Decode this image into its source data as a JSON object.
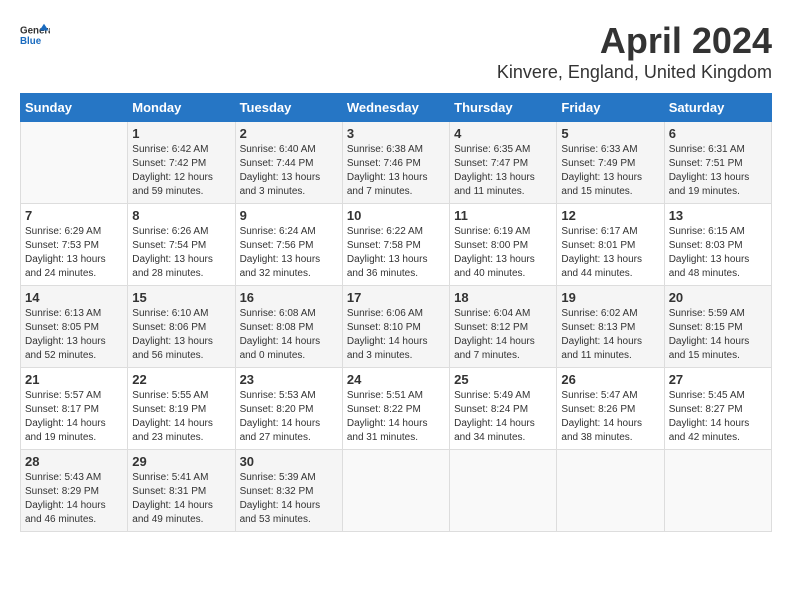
{
  "header": {
    "logo_general": "General",
    "logo_blue": "Blue",
    "title": "April 2024",
    "subtitle": "Kinvere, England, United Kingdom"
  },
  "calendar": {
    "columns": [
      "Sunday",
      "Monday",
      "Tuesday",
      "Wednesday",
      "Thursday",
      "Friday",
      "Saturday"
    ],
    "rows": [
      [
        {
          "day": "",
          "empty": true
        },
        {
          "day": "1",
          "sunrise": "Sunrise: 6:42 AM",
          "sunset": "Sunset: 7:42 PM",
          "daylight": "Daylight: 12 hours and 59 minutes."
        },
        {
          "day": "2",
          "sunrise": "Sunrise: 6:40 AM",
          "sunset": "Sunset: 7:44 PM",
          "daylight": "Daylight: 13 hours and 3 minutes."
        },
        {
          "day": "3",
          "sunrise": "Sunrise: 6:38 AM",
          "sunset": "Sunset: 7:46 PM",
          "daylight": "Daylight: 13 hours and 7 minutes."
        },
        {
          "day": "4",
          "sunrise": "Sunrise: 6:35 AM",
          "sunset": "Sunset: 7:47 PM",
          "daylight": "Daylight: 13 hours and 11 minutes."
        },
        {
          "day": "5",
          "sunrise": "Sunrise: 6:33 AM",
          "sunset": "Sunset: 7:49 PM",
          "daylight": "Daylight: 13 hours and 15 minutes."
        },
        {
          "day": "6",
          "sunrise": "Sunrise: 6:31 AM",
          "sunset": "Sunset: 7:51 PM",
          "daylight": "Daylight: 13 hours and 19 minutes."
        }
      ],
      [
        {
          "day": "7",
          "sunrise": "Sunrise: 6:29 AM",
          "sunset": "Sunset: 7:53 PM",
          "daylight": "Daylight: 13 hours and 24 minutes."
        },
        {
          "day": "8",
          "sunrise": "Sunrise: 6:26 AM",
          "sunset": "Sunset: 7:54 PM",
          "daylight": "Daylight: 13 hours and 28 minutes."
        },
        {
          "day": "9",
          "sunrise": "Sunrise: 6:24 AM",
          "sunset": "Sunset: 7:56 PM",
          "daylight": "Daylight: 13 hours and 32 minutes."
        },
        {
          "day": "10",
          "sunrise": "Sunrise: 6:22 AM",
          "sunset": "Sunset: 7:58 PM",
          "daylight": "Daylight: 13 hours and 36 minutes."
        },
        {
          "day": "11",
          "sunrise": "Sunrise: 6:19 AM",
          "sunset": "Sunset: 8:00 PM",
          "daylight": "Daylight: 13 hours and 40 minutes."
        },
        {
          "day": "12",
          "sunrise": "Sunrise: 6:17 AM",
          "sunset": "Sunset: 8:01 PM",
          "daylight": "Daylight: 13 hours and 44 minutes."
        },
        {
          "day": "13",
          "sunrise": "Sunrise: 6:15 AM",
          "sunset": "Sunset: 8:03 PM",
          "daylight": "Daylight: 13 hours and 48 minutes."
        }
      ],
      [
        {
          "day": "14",
          "sunrise": "Sunrise: 6:13 AM",
          "sunset": "Sunset: 8:05 PM",
          "daylight": "Daylight: 13 hours and 52 minutes."
        },
        {
          "day": "15",
          "sunrise": "Sunrise: 6:10 AM",
          "sunset": "Sunset: 8:06 PM",
          "daylight": "Daylight: 13 hours and 56 minutes."
        },
        {
          "day": "16",
          "sunrise": "Sunrise: 6:08 AM",
          "sunset": "Sunset: 8:08 PM",
          "daylight": "Daylight: 14 hours and 0 minutes."
        },
        {
          "day": "17",
          "sunrise": "Sunrise: 6:06 AM",
          "sunset": "Sunset: 8:10 PM",
          "daylight": "Daylight: 14 hours and 3 minutes."
        },
        {
          "day": "18",
          "sunrise": "Sunrise: 6:04 AM",
          "sunset": "Sunset: 8:12 PM",
          "daylight": "Daylight: 14 hours and 7 minutes."
        },
        {
          "day": "19",
          "sunrise": "Sunrise: 6:02 AM",
          "sunset": "Sunset: 8:13 PM",
          "daylight": "Daylight: 14 hours and 11 minutes."
        },
        {
          "day": "20",
          "sunrise": "Sunrise: 5:59 AM",
          "sunset": "Sunset: 8:15 PM",
          "daylight": "Daylight: 14 hours and 15 minutes."
        }
      ],
      [
        {
          "day": "21",
          "sunrise": "Sunrise: 5:57 AM",
          "sunset": "Sunset: 8:17 PM",
          "daylight": "Daylight: 14 hours and 19 minutes."
        },
        {
          "day": "22",
          "sunrise": "Sunrise: 5:55 AM",
          "sunset": "Sunset: 8:19 PM",
          "daylight": "Daylight: 14 hours and 23 minutes."
        },
        {
          "day": "23",
          "sunrise": "Sunrise: 5:53 AM",
          "sunset": "Sunset: 8:20 PM",
          "daylight": "Daylight: 14 hours and 27 minutes."
        },
        {
          "day": "24",
          "sunrise": "Sunrise: 5:51 AM",
          "sunset": "Sunset: 8:22 PM",
          "daylight": "Daylight: 14 hours and 31 minutes."
        },
        {
          "day": "25",
          "sunrise": "Sunrise: 5:49 AM",
          "sunset": "Sunset: 8:24 PM",
          "daylight": "Daylight: 14 hours and 34 minutes."
        },
        {
          "day": "26",
          "sunrise": "Sunrise: 5:47 AM",
          "sunset": "Sunset: 8:26 PM",
          "daylight": "Daylight: 14 hours and 38 minutes."
        },
        {
          "day": "27",
          "sunrise": "Sunrise: 5:45 AM",
          "sunset": "Sunset: 8:27 PM",
          "daylight": "Daylight: 14 hours and 42 minutes."
        }
      ],
      [
        {
          "day": "28",
          "sunrise": "Sunrise: 5:43 AM",
          "sunset": "Sunset: 8:29 PM",
          "daylight": "Daylight: 14 hours and 46 minutes."
        },
        {
          "day": "29",
          "sunrise": "Sunrise: 5:41 AM",
          "sunset": "Sunset: 8:31 PM",
          "daylight": "Daylight: 14 hours and 49 minutes."
        },
        {
          "day": "30",
          "sunrise": "Sunrise: 5:39 AM",
          "sunset": "Sunset: 8:32 PM",
          "daylight": "Daylight: 14 hours and 53 minutes."
        },
        {
          "day": "",
          "empty": true
        },
        {
          "day": "",
          "empty": true
        },
        {
          "day": "",
          "empty": true
        },
        {
          "day": "",
          "empty": true
        }
      ]
    ]
  }
}
